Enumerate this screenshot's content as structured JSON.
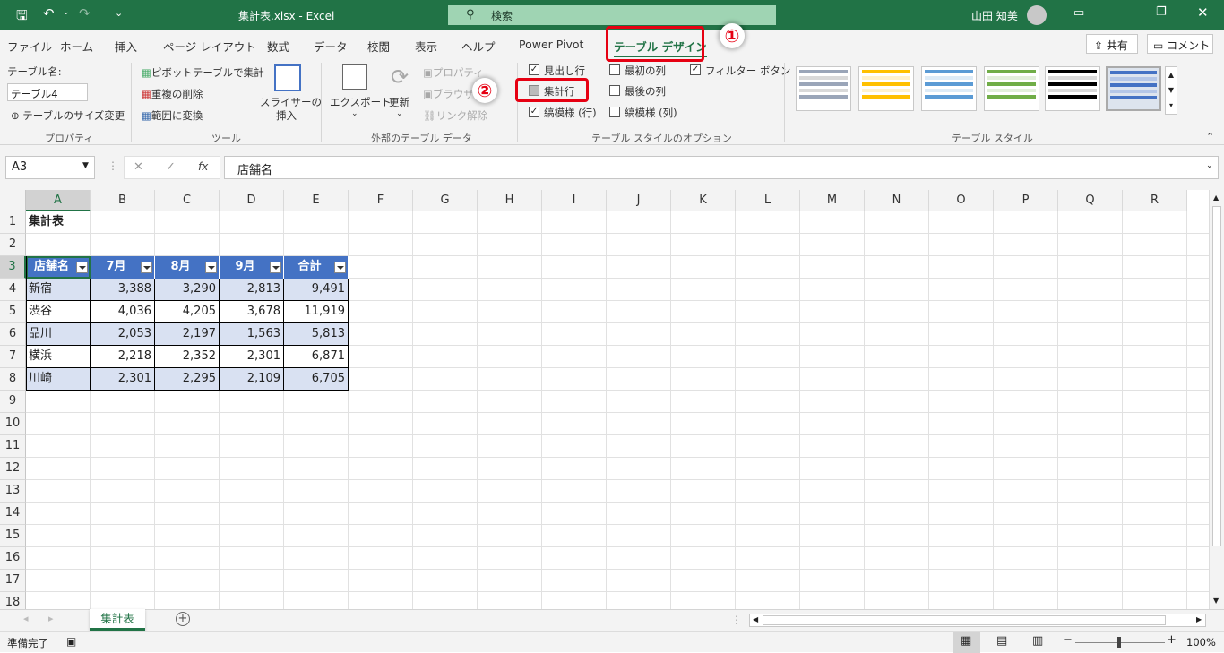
{
  "titlebar": {
    "title": "集計表.xlsx  -  Excel",
    "search_placeholder": "検索",
    "user": "山田 知美"
  },
  "tabs": [
    "ファイル",
    "ホーム",
    "挿入",
    "ページ レイアウト",
    "数式",
    "データ",
    "校閲",
    "表示",
    "ヘルプ",
    "Power Pivot",
    "テーブル デザイン"
  ],
  "share": "共有",
  "comment": "コメント",
  "ribbon": {
    "properties": {
      "label": "テーブル名:",
      "value": "テーブル4",
      "resize": "テーブルのサイズ変更",
      "group": "プロパティ"
    },
    "tools": {
      "pivot": "ピボットテーブルで集計",
      "dedupe": "重複の削除",
      "convert": "範囲に変換",
      "slicer1": "スライサーの",
      "slicer2": "挿入",
      "group": "ツール"
    },
    "external": {
      "export": "エクスポート",
      "refresh": "更新",
      "props": "プロパティ",
      "browser": "ブラウザー",
      "unlink": "リンク解除",
      "group": "外部のテーブル データ"
    },
    "options": {
      "header_row": "見出し行",
      "total_row": "集計行",
      "banded_rows": "縞模様 (行)",
      "first_col": "最初の列",
      "last_col": "最後の列",
      "banded_cols": "縞模様 (列)",
      "filter_button": "フィルター ボタン",
      "group": "テーブル スタイルのオプション"
    },
    "styles": {
      "group": "テーブル スタイル"
    }
  },
  "formula_bar": {
    "name_box": "A3",
    "content": "店舗名"
  },
  "columns": [
    "A",
    "B",
    "C",
    "D",
    "E",
    "F",
    "G",
    "H",
    "I",
    "J",
    "K",
    "L",
    "M",
    "N",
    "O",
    "P",
    "Q",
    "R"
  ],
  "rows": [
    "1",
    "2",
    "3",
    "4",
    "5",
    "6",
    "7",
    "8",
    "9",
    "10",
    "11",
    "12",
    "13",
    "14",
    "15",
    "16",
    "17",
    "18"
  ],
  "sheet": {
    "title": "集計表",
    "headers": [
      "店舗名",
      "7月",
      "8月",
      "9月",
      "合計"
    ],
    "data": [
      [
        "新宿",
        "3,388",
        "3,290",
        "2,813",
        "9,491"
      ],
      [
        "渋谷",
        "4,036",
        "4,205",
        "3,678",
        "11,919"
      ],
      [
        "品川",
        "2,053",
        "2,197",
        "1,563",
        "5,813"
      ],
      [
        "横浜",
        "2,218",
        "2,352",
        "2,301",
        "6,871"
      ],
      [
        "川崎",
        "2,301",
        "2,295",
        "2,109",
        "6,705"
      ]
    ]
  },
  "sheet_tab": "集計表",
  "status": {
    "ready": "準備完了",
    "zoom": "100%"
  },
  "callouts": [
    "①",
    "②"
  ],
  "colors": {
    "excel_green": "#217346",
    "table_header": "#4472c4",
    "band": "#d9e1f2",
    "callout_red": "#e60012"
  }
}
